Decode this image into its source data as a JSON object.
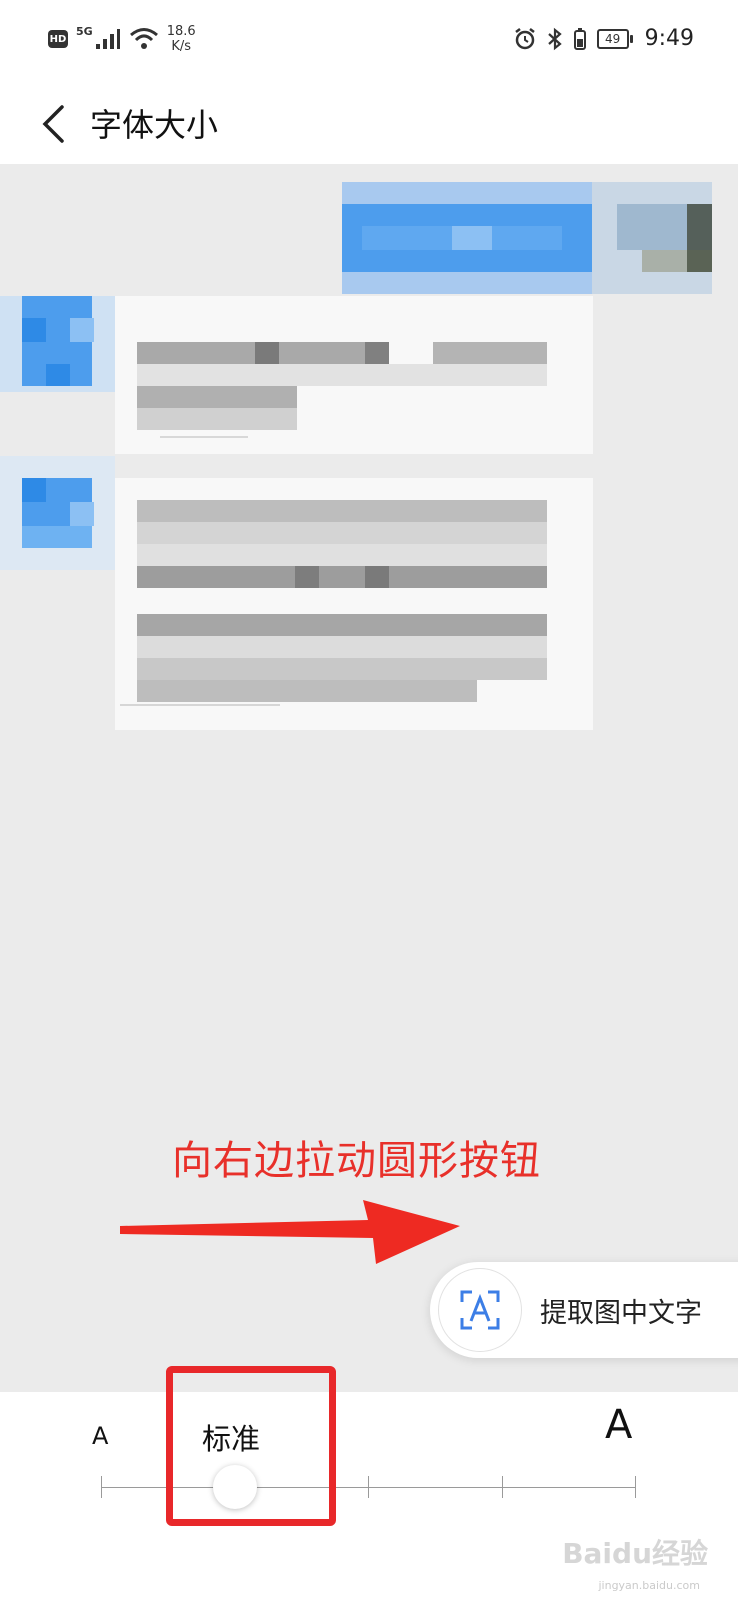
{
  "status_bar": {
    "network_type": "5G",
    "hd_label": "HD",
    "speed_value": "18.6",
    "speed_unit": "K/s",
    "battery_level": "49",
    "time": "9:49"
  },
  "header": {
    "title": "字体大小"
  },
  "annotation": {
    "text": "向右边拉动圆形按钮",
    "color": "#e8302a"
  },
  "extract_text": {
    "label": "提取图中文字"
  },
  "font_size_panel": {
    "small_label": "A",
    "large_label": "A",
    "current_label": "标准",
    "level_count": 5,
    "current_level": 2
  },
  "watermark": {
    "text": "Baidu经验",
    "sub": "jingyan.baidu.com"
  },
  "colors": {
    "accent_red": "#e8282a",
    "preview_bg": "#ebebeb",
    "bubble_blue": "#4a9cec"
  }
}
